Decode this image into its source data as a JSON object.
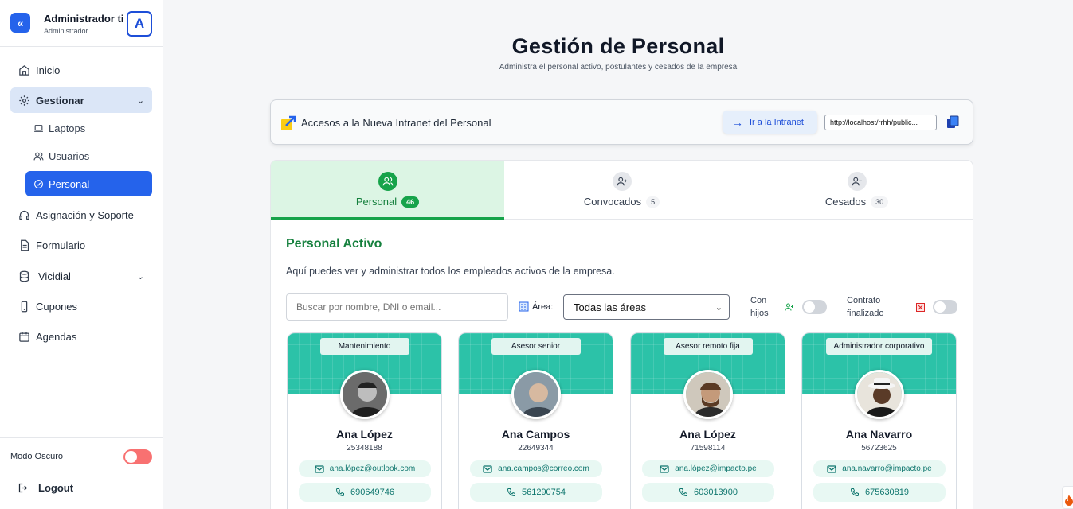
{
  "sidebar": {
    "user_name": "Administrador ti",
    "user_role": "Administrador",
    "avatar_letter": "A",
    "nav": {
      "inicio": "Inicio",
      "gestionar": "Gestionar",
      "laptops": "Laptops",
      "usuarios": "Usuarios",
      "personal": "Personal",
      "asignacion": "Asignación y Soporte",
      "formulario": "Formulario",
      "vicidial": "Vicidial",
      "cupones": "Cupones",
      "agendas": "Agendas"
    },
    "dark_mode_label": "Modo Oscuro",
    "logout_label": "Logout"
  },
  "header": {
    "title": "Gestión de Personal",
    "subtitle": "Administra el personal activo, postulantes y cesados de la empresa"
  },
  "intranet": {
    "label": "Accesos a la Nueva Intranet del Personal",
    "button_label": "Ir a la Intranet",
    "url_value": "http://localhost/rrhh/public..."
  },
  "tabs": [
    {
      "label": "Personal",
      "count": "46"
    },
    {
      "label": "Convocados",
      "count": "5"
    },
    {
      "label": "Cesados",
      "count": "30"
    }
  ],
  "section": {
    "title": "Personal Activo",
    "description": "Aquí puedes ver y administrar todos los empleados activos de la empresa."
  },
  "filters": {
    "search_placeholder": "Buscar por nombre, DNI o email...",
    "area_label": "Área:",
    "area_value": "Todas las áreas",
    "con_hijos_line1": "Con",
    "con_hijos_line2": "hijos",
    "contrato_line1": "Contrato",
    "contrato_line2": "finalizado"
  },
  "cards": [
    {
      "role": "Mantenimiento",
      "name": "Ana López",
      "dni": "25348188",
      "email": "ana.lópez@outlook.com",
      "phone": "690649746"
    },
    {
      "role": "Asesor senior",
      "name": "Ana Campos",
      "dni": "22649344",
      "email": "ana.campos@correo.com",
      "phone": "561290754"
    },
    {
      "role": "Asesor remoto fija",
      "name": "Ana López",
      "dni": "71598114",
      "email": "ana.lópez@impacto.pe",
      "phone": "603013900"
    },
    {
      "role": "Administrador corporativo",
      "name": "Ana Navarro",
      "dni": "56723625",
      "email": "ana.navarro@impacto.pe",
      "phone": "675630819"
    }
  ],
  "colors": {
    "primary": "#2563eb",
    "success": "#16a34a",
    "card_banner": "#2cc2a8",
    "dark_toggle": "#f87171"
  }
}
